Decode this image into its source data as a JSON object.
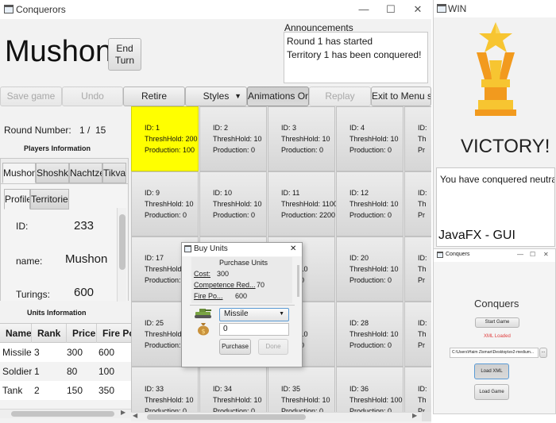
{
  "main_window": {
    "title": "Conquerors",
    "controls": {
      "minimize": "—",
      "maximize": "☐",
      "close": "✕"
    },
    "player_name": "Mushon",
    "end_turn_label": "End\nTurn",
    "announcements": {
      "title": "Announcements",
      "lines": [
        "Round 1 has started",
        "Territory 1 has been conquered!"
      ]
    },
    "toolbar": {
      "save_game": "Save game",
      "undo": "Undo",
      "retire": "Retire",
      "styles": "Styles",
      "animations": "Animations On",
      "replay": "Replay",
      "exit": "Exit to Menu s..."
    },
    "round": {
      "label": "Round Number:",
      "current": "1",
      "separator": "/",
      "total": "15"
    },
    "players_info_title": "Players Information",
    "player_tabs": [
      "Mushon",
      "Shoshke",
      "Nachtze",
      "Tikva"
    ],
    "sub_tabs": [
      "Profile",
      "Territories"
    ],
    "profile": {
      "id_label": "ID:",
      "id_value": "233",
      "name_label": "name:",
      "name_value": "Mushon",
      "turings_label": "Turings:",
      "turings_value": "600"
    },
    "units_info_title": "Units Information",
    "units_table": {
      "headers": [
        "Name",
        "Rank",
        "Price",
        "Fire Pow"
      ],
      "rows": [
        [
          "Missile",
          "3",
          "300",
          "600"
        ],
        [
          "Soldier",
          "1",
          "80",
          "100"
        ],
        [
          "Tank",
          "2",
          "150",
          "350"
        ]
      ]
    },
    "territories": [
      {
        "id": "ID: 1",
        "hold": "ThreshHold: 200",
        "prod": "Production: 100"
      },
      {
        "id": "ID: 2",
        "hold": "ThreshHold: 10",
        "prod": "Production: 0"
      },
      {
        "id": "ID: 3",
        "hold": "ThreshHold: 10",
        "prod": "Production: 0"
      },
      {
        "id": "ID: 4",
        "hold": "ThreshHold: 10",
        "prod": "Production: 0"
      },
      {
        "id": "ID:",
        "hold": "Th",
        "prod": "Pr"
      },
      {
        "id": "ID: 9",
        "hold": "ThreshHold: 10",
        "prod": "Production: 0"
      },
      {
        "id": "ID: 10",
        "hold": "ThreshHold: 10",
        "prod": "Production: 0"
      },
      {
        "id": "ID: 11",
        "hold": "ThreshHold: 1100",
        "prod": "Production: 2200"
      },
      {
        "id": "ID: 12",
        "hold": "ThreshHold: 10",
        "prod": "Production: 0"
      },
      {
        "id": "ID:",
        "hold": "Th",
        "prod": "Pr"
      },
      {
        "id": "ID: 17",
        "hold": "ThreshHold: 1",
        "prod": "Production: 0"
      },
      {
        "id": "",
        "hold": "",
        "prod": ""
      },
      {
        "id": "",
        "hold": "Hold: 10",
        "prod": "ction: 0"
      },
      {
        "id": "ID: 20",
        "hold": "ThreshHold: 10",
        "prod": "Production: 0"
      },
      {
        "id": "ID:",
        "hold": "Th",
        "prod": "Pr"
      },
      {
        "id": "ID: 25",
        "hold": "ThreshHold: 1",
        "prod": "Production: 0"
      },
      {
        "id": "",
        "hold": "",
        "prod": ""
      },
      {
        "id": "",
        "hold": "Hold: 10",
        "prod": "ction: 0"
      },
      {
        "id": "ID: 28",
        "hold": "ThreshHold: 10",
        "prod": "Production: 0"
      },
      {
        "id": "ID:",
        "hold": "Th",
        "prod": "Pr"
      },
      {
        "id": "ID: 33",
        "hold": "ThreshHold: 10",
        "prod": "Production: 0"
      },
      {
        "id": "ID: 34",
        "hold": "ThreshHold: 10",
        "prod": "Production: 0"
      },
      {
        "id": "ID: 35",
        "hold": "ThreshHold: 10",
        "prod": "Production: 0"
      },
      {
        "id": "ID: 36",
        "hold": "ThreshHold: 100",
        "prod": "Production: 0"
      },
      {
        "id": "ID:",
        "hold": "Th",
        "prod": "Pr"
      }
    ]
  },
  "buy_units_dialog": {
    "title": "Buy Units",
    "close": "✕",
    "heading": "Purchase Units",
    "cost_label": "Cost:",
    "cost_value": "300",
    "competence_label": "Competence Red...",
    "competence_value": "70",
    "fire_label": "Fire Po...",
    "fire_value": "600",
    "unit_select": "Missile",
    "amount_value": "0",
    "purchase": "Purchase",
    "done": "Done"
  },
  "win_window": {
    "title": "WIN",
    "victory": "VICTORY!",
    "message": "You have conquered neutral territory",
    "caption": "JavaFX - GUI"
  },
  "menu_window": {
    "title": "Conquers",
    "heading": "Conquers",
    "start_game": "Start Game",
    "xml_status": "XML Loaded",
    "path_value": "C:\\Users\\Haim Zisman\\Desktop\\ex2-medium...",
    "browse": "...",
    "load_xml": "Load XML",
    "load_game": "Load Game"
  },
  "colors": {
    "owned_territory": "#ffff00",
    "xml_status": "#e03c3c",
    "trophy_gold": "#f7c531",
    "trophy_orange": "#f29a1e"
  }
}
